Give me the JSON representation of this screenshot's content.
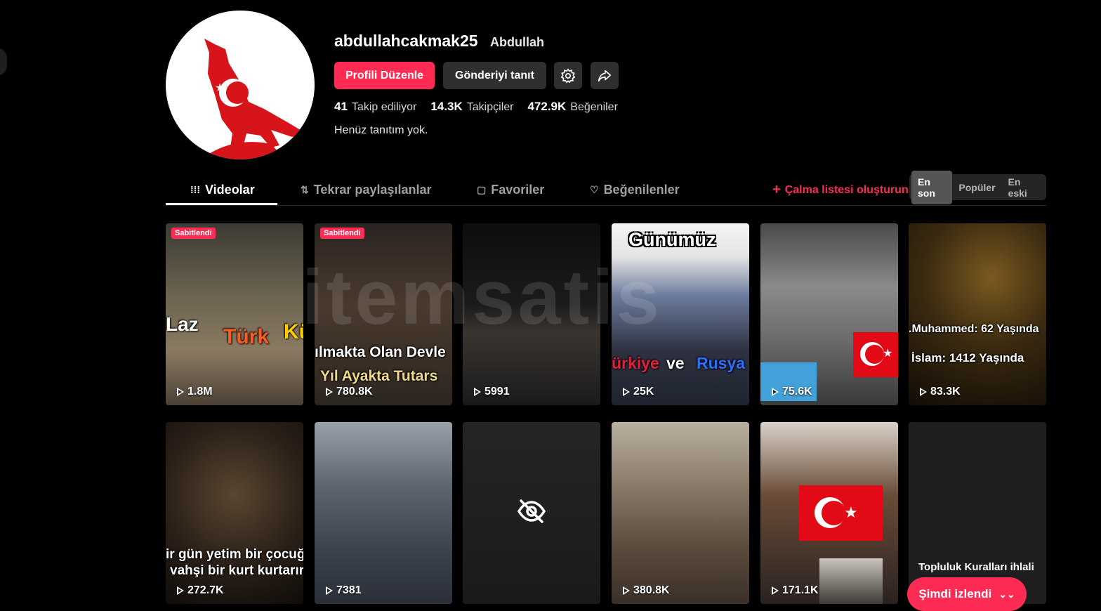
{
  "profile": {
    "username": "abdullahcakmak25",
    "nickname": "Abdullah",
    "bio": "Henüz tanıtım yok.",
    "stats": [
      {
        "value": "41",
        "label": "Takip ediliyor"
      },
      {
        "value": "14.3K",
        "label": "Takipçiler"
      },
      {
        "value": "472.9K",
        "label": "Beğeniler"
      }
    ]
  },
  "actions": {
    "edit_label": "Profili Düzenle",
    "promote_label": "Gönderiyi tanıt",
    "settings_icon": "gear-icon",
    "share_icon": "share-icon"
  },
  "tabs": [
    {
      "label": "Videolar",
      "icon": "grid-icon",
      "active": true
    },
    {
      "label": "Tekrar paylaşılanlar",
      "icon": "repost-icon"
    },
    {
      "label": "Favoriler",
      "icon": "bookmark-icon"
    },
    {
      "label": "Beğenilenler",
      "icon": "heart-icon"
    }
  ],
  "playlist_label": "Çalma listesi oluşturun",
  "sort": {
    "options": [
      "En son",
      "Popüler",
      "En eski"
    ],
    "selected": "En son"
  },
  "videos": [
    {
      "views": "1.8M",
      "pinned": "Sabitlendi",
      "overlay": [
        "Laz",
        "Türk",
        "Kü"
      ]
    },
    {
      "views": "780.8K",
      "pinned": "Sabitlendi",
      "overlay": [
        "ılmakta Olan Devle",
        "Yıl Ayakta Tutars"
      ]
    },
    {
      "views": "5991"
    },
    {
      "views": "25K",
      "overlay": [
        "Günümüz",
        "ürkiye",
        "ve",
        "Rusya"
      ]
    },
    {
      "views": "75.6K"
    },
    {
      "views": "83.3K",
      "overlay": [
        ".Muhammed: 62 Yaşında",
        "İslam: 1412 Yaşında"
      ]
    },
    {
      "views": "272.7K",
      "overlay": [
        "ir gün yetim bir çocuğu",
        "vahşi bir kurt kurtarır"
      ]
    },
    {
      "views": "7381"
    },
    {
      "hidden": true
    },
    {
      "views": "380.8K"
    },
    {
      "views": "171.1K"
    },
    {
      "violation": "Topluluk Kuralları ihlali"
    }
  ],
  "watch_button": "Şimdi izlendi",
  "watermark": "itemsatis",
  "colors": {
    "accent": "#fe2c55",
    "background": "#000000",
    "flag_red": "#e30a17"
  }
}
